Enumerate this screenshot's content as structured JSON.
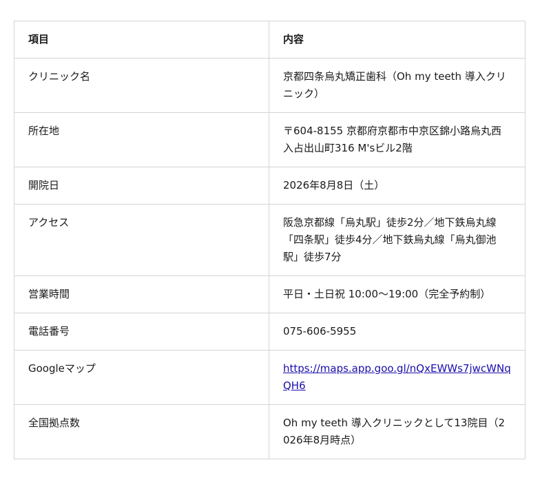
{
  "table": {
    "headers": [
      "項目",
      "内容"
    ],
    "rows": [
      {
        "label": "クリニック名",
        "value": "京都四条烏丸矯正歯科（Oh my teeth 導入クリニック）"
      },
      {
        "label": "所在地",
        "value": "〒604-8155 京都府京都市中京区錦小路烏丸西入占出山町316 M'sビル2階"
      },
      {
        "label": "開院日",
        "value": "2026年8月8日（土）"
      },
      {
        "label": "アクセス",
        "value": "阪急京都線「烏丸駅」徒歩2分／地下鉄烏丸線「四条駅」徒歩4分／地下鉄烏丸線「烏丸御池駅」徒歩7分"
      },
      {
        "label": "営業時間",
        "value": "平日・土日祝 10:00〜19:00（完全予約制）"
      },
      {
        "label": "電話番号",
        "value": "075-606-5955"
      },
      {
        "label": "Googleマップ",
        "value": "https://maps.app.goo.gl/nQxEWWs7jwcWNqQH6"
      },
      {
        "label": "全国拠点数",
        "value": "Oh my teeth 導入クリニックとして13院目（2026年8月時点）"
      }
    ]
  },
  "colors": {
    "border": "#d4d4d4",
    "text": "#1a1a1a",
    "link": "#1a0dab"
  }
}
